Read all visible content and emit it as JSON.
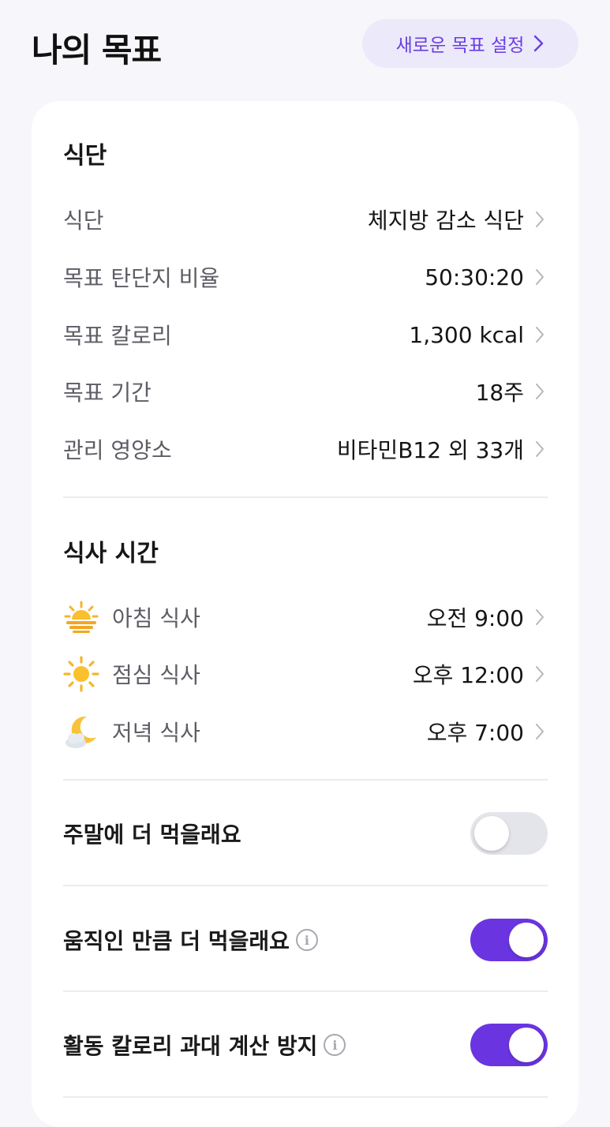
{
  "header": {
    "title": "나의 목표",
    "new_goal_label": "새로운 목표 설정"
  },
  "diet": {
    "section_title": "식단",
    "rows": [
      {
        "label": "식단",
        "value": "체지방 감소 식단"
      },
      {
        "label": "목표 탄단지 비율",
        "value": "50:30:20"
      },
      {
        "label": "목표 칼로리",
        "value": "1,300 kcal"
      },
      {
        "label": "목표 기간",
        "value": "18주"
      },
      {
        "label": "관리 영양소",
        "value": "비타민B12 외 33개"
      }
    ]
  },
  "meal_times": {
    "section_title": "식사 시간",
    "rows": [
      {
        "icon": "sunrise-icon",
        "label": "아침 식사",
        "value": "오전 9:00"
      },
      {
        "icon": "sun-icon",
        "label": "점심 식사",
        "value": "오후 12:00"
      },
      {
        "icon": "moon-cloud-icon",
        "label": "저녁 식사",
        "value": "오후 7:00"
      }
    ]
  },
  "toggles": [
    {
      "label": "주말에 더 먹을래요",
      "enabled": false,
      "has_info": false
    },
    {
      "label": "움직인 만큼 더 먹을래요",
      "enabled": true,
      "has_info": true
    },
    {
      "label": "활동 칼로리 과대 계산 방지",
      "enabled": true,
      "has_info": true
    }
  ],
  "colors": {
    "accent": "#6a35e0",
    "accent_soft": "#ece9fb",
    "toggle_off": "#e4e5ea"
  }
}
